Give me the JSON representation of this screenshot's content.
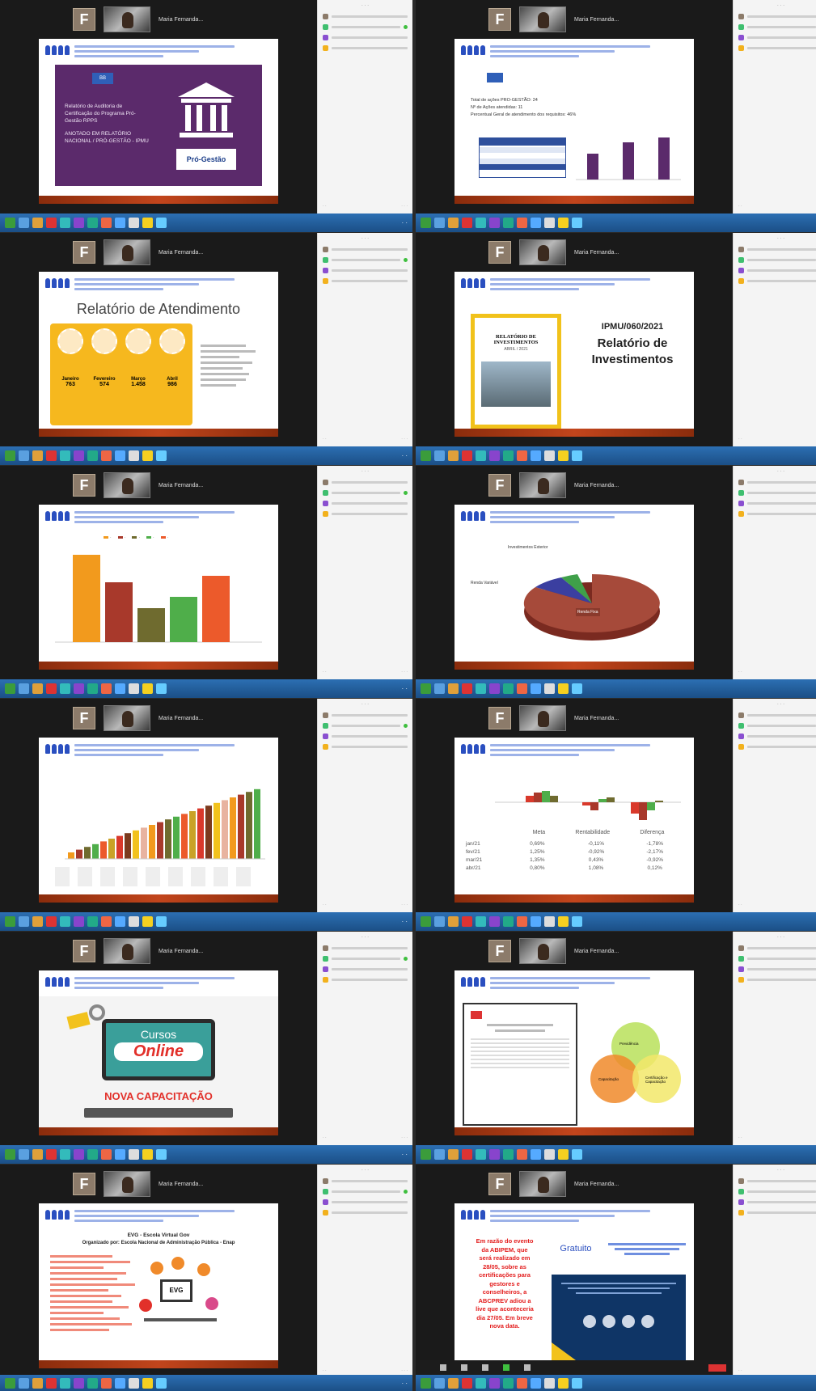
{
  "meeting": {
    "avatar_letter": "F",
    "participant_label": "Maria Fernanda..."
  },
  "slides": [
    {
      "type": "cover",
      "lines": [
        "Relatório de Auditoria de",
        "Certificação do Programa Pró-",
        "Gestão RPPS"
      ],
      "sub": [
        "ANOTADO EM RELATÓRIO",
        "NACIONAL / PRÓ-GESTÃO - IPMU"
      ],
      "badge": "Pró-Gestão"
    },
    {
      "type": "table-bars",
      "text": [
        "Total de ações PRO-GESTÃO: 24",
        "Nº de Ações atendidas: 11",
        "Percentual Geral de atendimento dos requisitos: 46%"
      ]
    },
    {
      "type": "atendimento",
      "title": "Relatório de Atendimento",
      "months": [
        {
          "name": "Janeiro",
          "value": "763"
        },
        {
          "name": "Fevereiro",
          "value": "574"
        },
        {
          "name": "Março",
          "value": "1.458"
        },
        {
          "name": "Abril",
          "value": "986"
        }
      ]
    },
    {
      "type": "investimentos",
      "code": "IPMU/060/2021",
      "title_a": "Relatório de",
      "title_b": "Investimentos",
      "book_title_a": "RELATÓRIO DE",
      "book_title_b": "INVESTIMENTOS",
      "book_sub": "ABRIL / 2021"
    },
    {
      "type": "bars5"
    },
    {
      "type": "pie",
      "labels": [
        "Renda Fixa",
        "Renda Variável",
        "Investimentos Exterior"
      ]
    },
    {
      "type": "growth"
    },
    {
      "type": "meta",
      "columns": [
        "Meta",
        "Rentabilidade",
        "Diferença"
      ],
      "rows": [
        {
          "label": "jan/21",
          "c": [
            "0,69%",
            "-0,11%",
            "-1,78%"
          ]
        },
        {
          "label": "fev/21",
          "c": [
            "1,25%",
            "-0,92%",
            "-2,17%"
          ]
        },
        {
          "label": "mar/21",
          "c": [
            "1,35%",
            "0,43%",
            "-0,92%"
          ]
        },
        {
          "label": "abr/21",
          "c": [
            "0,80%",
            "1,08%",
            "0,12%"
          ]
        }
      ]
    },
    {
      "type": "cursos",
      "word_a": "Cursos",
      "word_b": "Online",
      "banner": "NOVA CAPACITAÇÃO"
    },
    {
      "type": "venn",
      "labels": [
        "Previdência",
        "Capacitação",
        "Certificação e Capacitação"
      ]
    },
    {
      "type": "evg",
      "title_a": "EVG - Escola Virtual Gov",
      "title_b": "Organizado por: Escola Nacional de Administração Pública - Enap",
      "screen": "EVG"
    },
    {
      "type": "abipem",
      "note": [
        "Em razão do evento",
        "da ABIPEM, que",
        "será realizado em",
        "28/05, sobre as",
        "certificações para",
        "gestores e",
        "conselheiros, a",
        "ABCPREV adiou a",
        "live que aconteceria",
        "dia 27/05. Em breve",
        "nova data."
      ],
      "gratis": "Gratuito"
    }
  ],
  "colors": {
    "purple": "#5b2a6b",
    "footer": "#c2451c",
    "bar_orange": "#f29a1d",
    "bar_red": "#a8392b",
    "bar_olive": "#6f6b2f",
    "bar_green": "#4fae4a",
    "bar_redorange": "#ec5a2b"
  }
}
